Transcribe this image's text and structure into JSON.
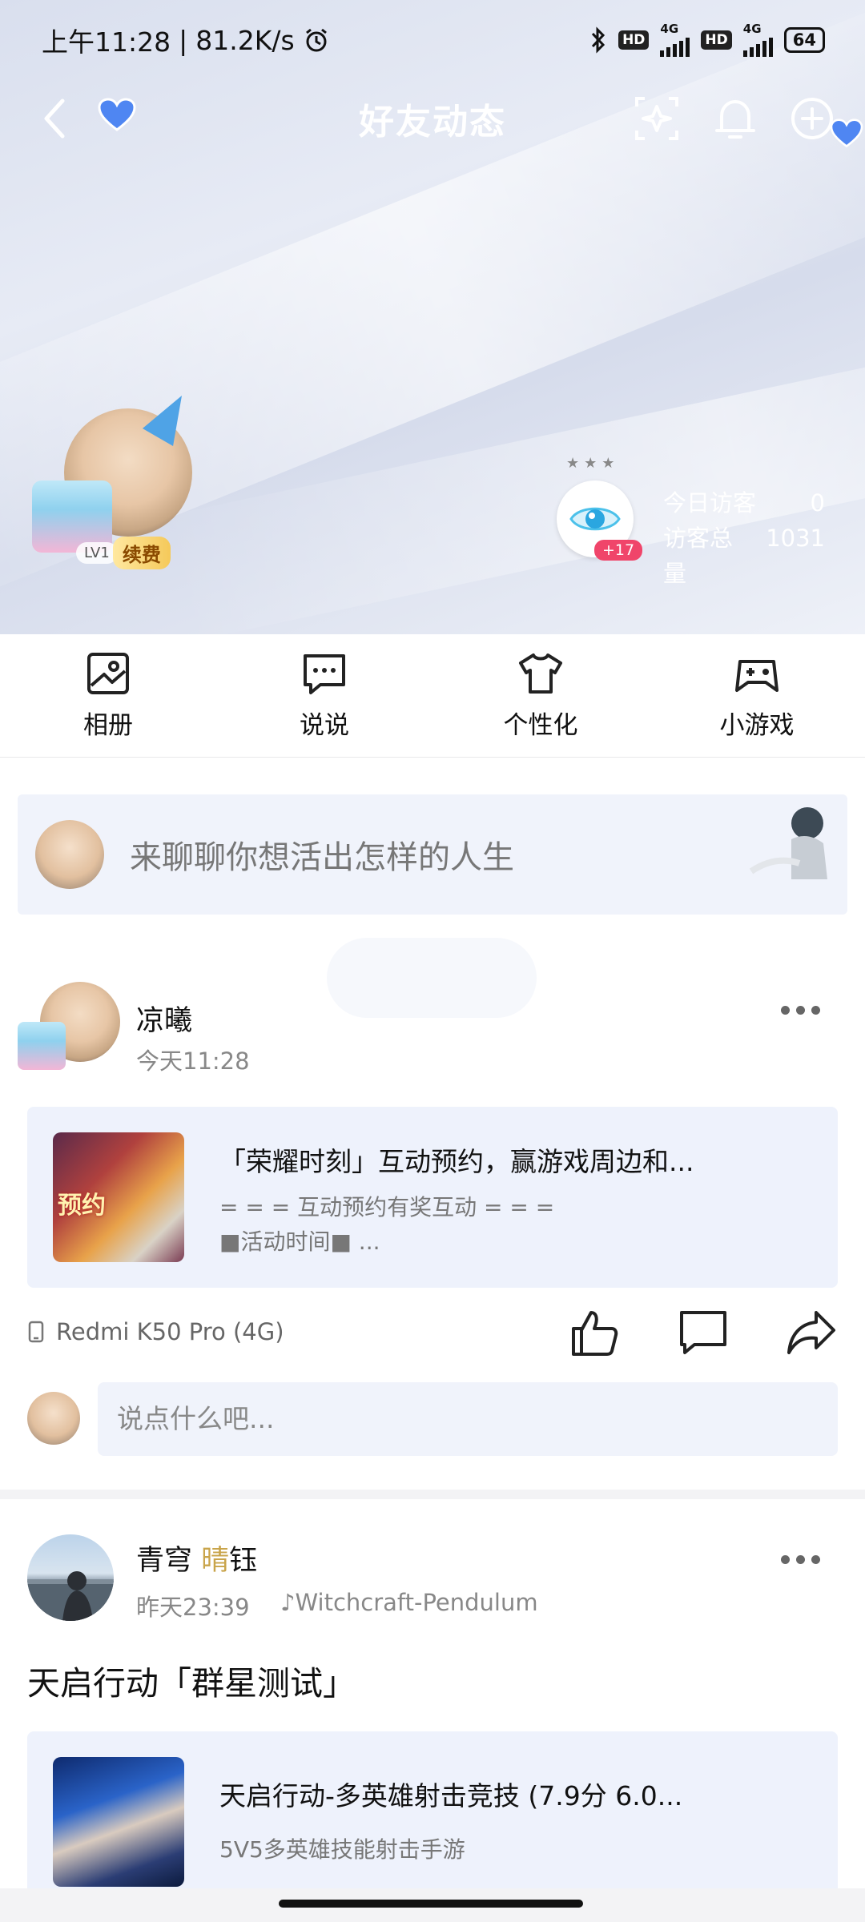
{
  "status_bar": {
    "time": "上午11:28",
    "speed": "81.2K/s",
    "hd1": "HD",
    "net1": "4G",
    "hd2": "HD",
    "net2": "4G",
    "battery": "64"
  },
  "nav": {
    "title": "好友动态"
  },
  "profile": {
    "level": "LV1",
    "renew_label": "续费",
    "visitors_plus": "+17",
    "today_visitors_label": "今日访客",
    "today_visitors_value": "0",
    "total_visitors_label": "访客总量",
    "total_visitors_value": "1031"
  },
  "quick_nav": [
    {
      "label": "相册",
      "icon": "album-icon"
    },
    {
      "label": "说说",
      "icon": "talk-icon"
    },
    {
      "label": "个性化",
      "icon": "tshirt-icon"
    },
    {
      "label": "小游戏",
      "icon": "gamepad-icon"
    }
  ],
  "composer": {
    "placeholder": "来聊聊你想活出怎样的人生"
  },
  "post1": {
    "author": "凉曦",
    "time": "今天11:28",
    "card_title": "「荣耀时刻」互动预约，赢游戏周边和...",
    "card_desc_line1": "= = = 互动预约有奖互动 = = =",
    "card_desc_line2": "■活动时间■  ...",
    "thumb_text": "预约",
    "device": "Redmi K50 Pro (4G)",
    "comment_placeholder": "说点什么吧..."
  },
  "post2": {
    "author_part1": "青穹 ",
    "author_highlight": "晴",
    "author_part2": "钰",
    "time": "昨天23:39",
    "song": "♪Witchcraft-Pendulum",
    "text": "天启行动「群星测试」",
    "card_title": "天启行动-多英雄射击竞技 (7.9分 6.0...",
    "card_desc": "5V5多英雄技能射击手游"
  },
  "colors": {
    "accent_pink": "#f0456a",
    "renew_gold": "#f5c95a",
    "card_bg": "#eef2fc"
  }
}
